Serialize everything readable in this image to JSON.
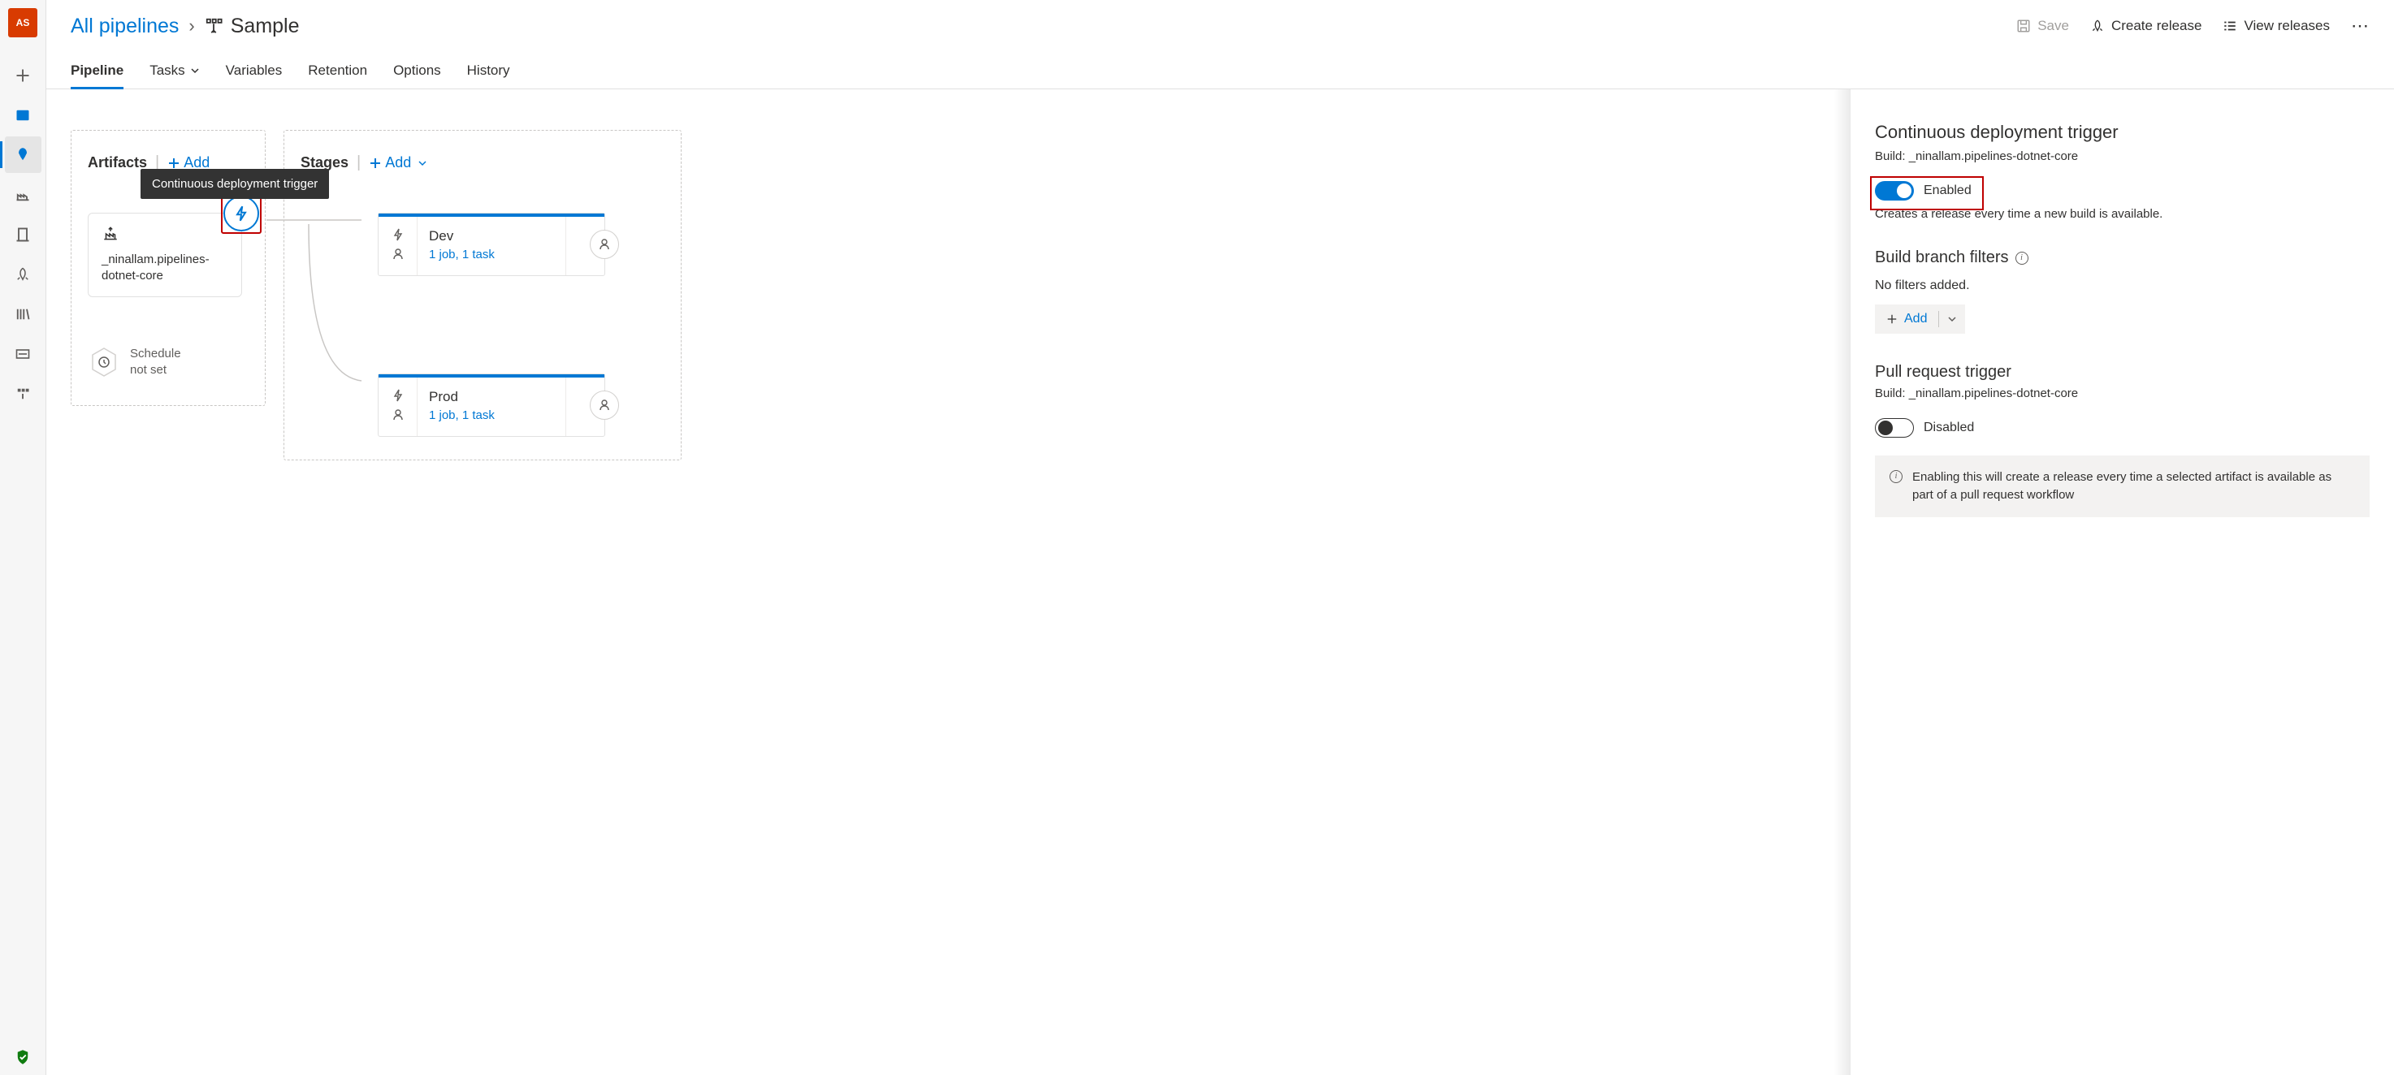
{
  "sidebar": {
    "avatar_initials": "AS"
  },
  "breadcrumb": {
    "root": "All pipelines",
    "sep": "›",
    "current": "Sample"
  },
  "header_actions": {
    "save": "Save",
    "create_release": "Create release",
    "view_releases": "View releases"
  },
  "tabs": {
    "pipeline": "Pipeline",
    "tasks": "Tasks",
    "variables": "Variables",
    "retention": "Retention",
    "options": "Options",
    "history": "History"
  },
  "artifacts": {
    "section_title": "Artifacts",
    "add_label": "Add",
    "tooltip": "Continuous deployment trigger",
    "card_name": "_ninallam.pipelines-dotnet-core",
    "schedule_line1": "Schedule",
    "schedule_line2": "not set"
  },
  "stages": {
    "section_title": "Stages",
    "add_label": "Add",
    "items": [
      {
        "name": "Dev",
        "sub": "1 job, 1 task"
      },
      {
        "name": "Prod",
        "sub": "1 job, 1 task"
      }
    ]
  },
  "panel": {
    "cd_title": "Continuous deployment trigger",
    "cd_build": "Build: _ninallam.pipelines-dotnet-core",
    "cd_toggle_label": "Enabled",
    "cd_desc": "Creates a release every time a new build is available.",
    "filters_title": "Build branch filters",
    "filters_empty": "No filters added.",
    "filters_add": "Add",
    "pr_title": "Pull request trigger",
    "pr_build": "Build: _ninallam.pipelines-dotnet-core",
    "pr_toggle_label": "Disabled",
    "pr_info": "Enabling this will create a release every time a selected artifact is available as part of a pull request workflow"
  }
}
